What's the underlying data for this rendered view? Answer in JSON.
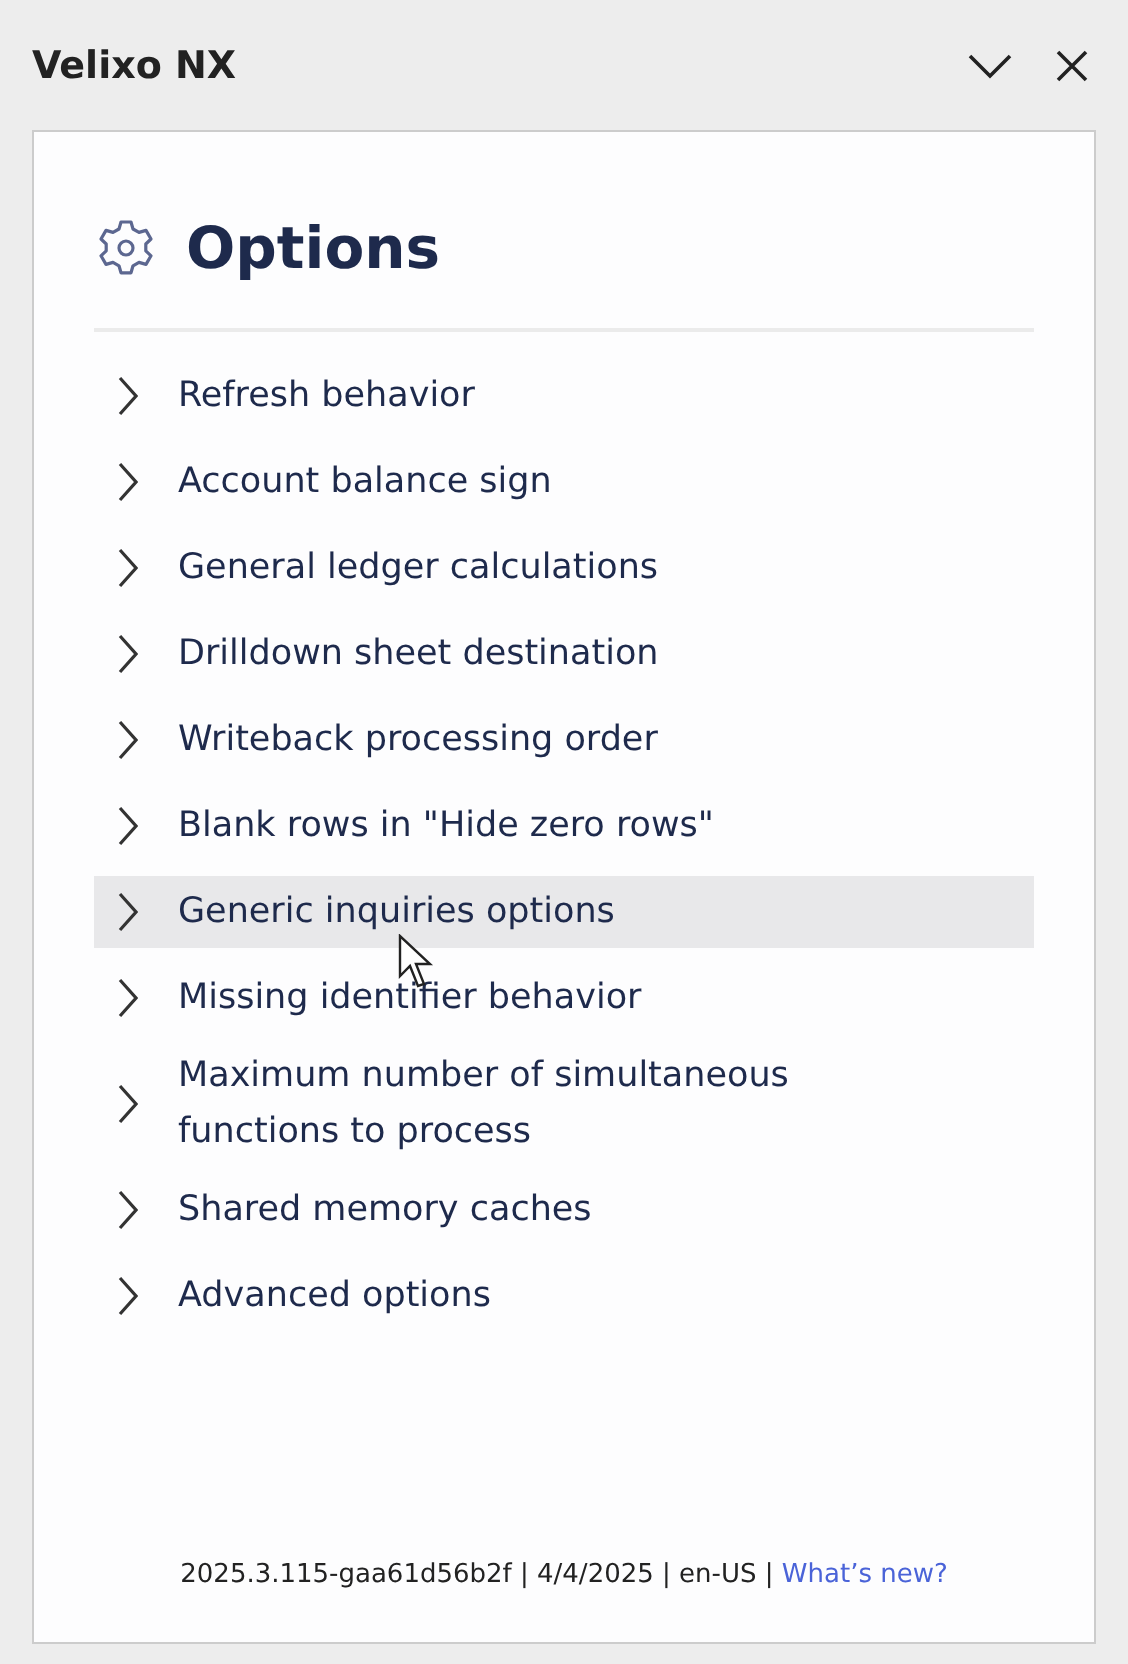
{
  "window": {
    "title": "Velixo NX"
  },
  "panel": {
    "title": "Options",
    "items": [
      {
        "label": "Refresh behavior",
        "hovered": false
      },
      {
        "label": "Account balance sign",
        "hovered": false
      },
      {
        "label": "General ledger calculations",
        "hovered": false
      },
      {
        "label": "Drilldown sheet destination",
        "hovered": false
      },
      {
        "label": "Writeback processing order",
        "hovered": false
      },
      {
        "label": "Blank rows in \"Hide zero rows\"",
        "hovered": false
      },
      {
        "label": "Generic inquiries options",
        "hovered": true
      },
      {
        "label": "Missing identifier behavior",
        "hovered": false
      },
      {
        "label": "Maximum number of simultaneous functions to process",
        "hovered": false
      },
      {
        "label": "Shared memory caches",
        "hovered": false
      },
      {
        "label": "Advanced options",
        "hovered": false
      }
    ],
    "footer": {
      "text": "2025.3.115-gaa61d56b2f | 4/4/2025 | en-US |",
      "link": "What’s new?"
    }
  }
}
